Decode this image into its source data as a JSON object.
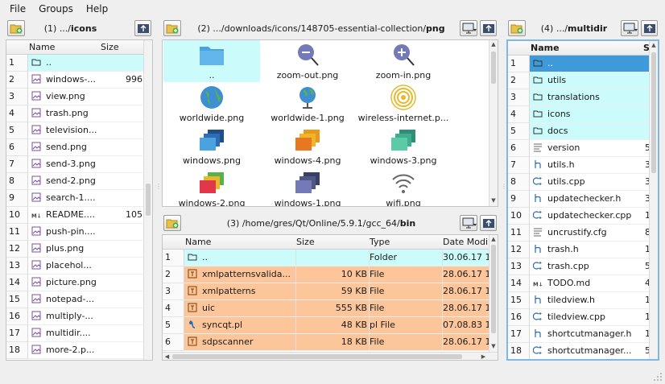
{
  "menu": [
    "File",
    "Groups",
    "Help"
  ],
  "panel1": {
    "prefix": "(1) .../",
    "bold": "icons",
    "columns": [
      "Name",
      "Size"
    ],
    "rows": [
      {
        "n": "1",
        "name": "..",
        "size": "",
        "icon": "folder-icon",
        "style": "cyan"
      },
      {
        "n": "2",
        "name": "windows-...",
        "size": "996",
        "icon": "image-file-icon"
      },
      {
        "n": "3",
        "name": "view.png",
        "size": "",
        "icon": "image-file-icon"
      },
      {
        "n": "4",
        "name": "trash.png",
        "size": "",
        "icon": "image-file-icon"
      },
      {
        "n": "5",
        "name": "television...",
        "size": "",
        "icon": "image-file-icon"
      },
      {
        "n": "6",
        "name": "send.png",
        "size": "",
        "icon": "image-file-icon"
      },
      {
        "n": "7",
        "name": "send-3.png",
        "size": "",
        "icon": "image-file-icon"
      },
      {
        "n": "8",
        "name": "send-2.png",
        "size": "",
        "icon": "image-file-icon"
      },
      {
        "n": "9",
        "name": "search-1....",
        "size": "",
        "icon": "image-file-icon"
      },
      {
        "n": "10",
        "name": "README....",
        "size": "105",
        "icon": "markdown-file-icon"
      },
      {
        "n": "11",
        "name": "push-pin....",
        "size": "",
        "icon": "image-file-icon"
      },
      {
        "n": "12",
        "name": "plus.png",
        "size": "",
        "icon": "image-file-icon"
      },
      {
        "n": "13",
        "name": "placehol...",
        "size": "",
        "icon": "image-file-icon"
      },
      {
        "n": "14",
        "name": "picture.png",
        "size": "",
        "icon": "image-file-icon"
      },
      {
        "n": "15",
        "name": "notepad-...",
        "size": "",
        "icon": "image-file-icon"
      },
      {
        "n": "16",
        "name": "multiply-...",
        "size": "",
        "icon": "image-file-icon"
      },
      {
        "n": "17",
        "name": "multidir....",
        "size": "",
        "icon": "image-file-icon"
      },
      {
        "n": "18",
        "name": "more-2.p...",
        "size": "",
        "icon": "image-file-icon"
      }
    ]
  },
  "panel2": {
    "prefix": "(2) .../downloads/icons/148705-essential-collection/",
    "bold": "png",
    "tiles": [
      {
        "label": "..",
        "icon": "folder-icon",
        "sel": true
      },
      {
        "label": "zoom-out.png",
        "icon": "zoom-out-icon"
      },
      {
        "label": "zoom-in.png",
        "icon": "zoom-in-icon"
      },
      {
        "label": "worldwide.png",
        "icon": "globe-icon"
      },
      {
        "label": "worldwide-1.png",
        "icon": "desk-globe-icon"
      },
      {
        "label": "wireless-internet.p...",
        "icon": "wireless-signal-icon"
      },
      {
        "label": "windows.png",
        "icon": "windows-stack-blue-icon"
      },
      {
        "label": "windows-4.png",
        "icon": "windows-stack-orange-icon"
      },
      {
        "label": "windows-3.png",
        "icon": "windows-stack-teal-icon"
      },
      {
        "label": "windows-2.png",
        "icon": "windows-stack-red-icon"
      },
      {
        "label": "windows-1.png",
        "icon": "windows-stack-purple-icon"
      },
      {
        "label": "wifi.png",
        "icon": "wifi-icon"
      }
    ]
  },
  "panel3": {
    "prefix": "(3) /home/gres/Qt/Online/5.9.1/gcc_64/",
    "bold": "bin",
    "columns": [
      "Name",
      "Size",
      "Type",
      "Date Modi"
    ],
    "rows": [
      {
        "n": "1",
        "name": "..",
        "size": "",
        "type": "Folder",
        "date": "30.06.17 1",
        "icon": "folder-icon",
        "style": "cyan"
      },
      {
        "n": "2",
        "name": "xmlpatternsvalida...",
        "size": "10 KB",
        "type": "File",
        "date": "28.06.17 1",
        "icon": "binary-file-icon",
        "style": "orange"
      },
      {
        "n": "3",
        "name": "xmlpatterns",
        "size": "59 KB",
        "type": "File",
        "date": "28.06.17 1",
        "icon": "binary-file-icon",
        "style": "orange"
      },
      {
        "n": "4",
        "name": "uic",
        "size": "555 KB",
        "type": "File",
        "date": "28.06.17 1",
        "icon": "binary-file-icon",
        "style": "orange"
      },
      {
        "n": "5",
        "name": "syncqt.pl",
        "size": "48 KB",
        "type": "pl File",
        "date": "07.08.83 1",
        "icon": "perl-file-icon",
        "style": "orange"
      },
      {
        "n": "6",
        "name": "sdpscanner",
        "size": "18 KB",
        "type": "File",
        "date": "28.06.17 1",
        "icon": "binary-file-icon",
        "style": "orange"
      }
    ]
  },
  "panel4": {
    "prefix": "(4) .../",
    "bold": "multidir",
    "columns": [
      "Name",
      "S"
    ],
    "rows": [
      {
        "n": "1",
        "name": "..",
        "size": "",
        "icon": "folder-icon",
        "style": "sel"
      },
      {
        "n": "2",
        "name": "utils",
        "size": "",
        "icon": "folder-icon",
        "style": "cyan"
      },
      {
        "n": "3",
        "name": "translations",
        "size": "",
        "icon": "folder-icon",
        "style": "cyan"
      },
      {
        "n": "4",
        "name": "icons",
        "size": "",
        "icon": "folder-icon",
        "style": "cyan"
      },
      {
        "n": "5",
        "name": "docs",
        "size": "",
        "icon": "folder-icon",
        "style": "cyan"
      },
      {
        "n": "6",
        "name": "version",
        "size": "5",
        "icon": "text-file-icon"
      },
      {
        "n": "7",
        "name": "utils.h",
        "size": "3",
        "icon": "header-file-icon"
      },
      {
        "n": "8",
        "name": "utils.cpp",
        "size": "3",
        "icon": "cpp-file-icon"
      },
      {
        "n": "9",
        "name": "updatechecker.h",
        "size": "3",
        "icon": "header-file-icon"
      },
      {
        "n": "10",
        "name": "updatechecker.cpp",
        "size": "1",
        "icon": "cpp-file-icon"
      },
      {
        "n": "11",
        "name": "uncrustify.cfg",
        "size": "8",
        "icon": "text-file-icon"
      },
      {
        "n": "12",
        "name": "trash.h",
        "size": "1",
        "icon": "header-file-icon"
      },
      {
        "n": "13",
        "name": "trash.cpp",
        "size": "5",
        "icon": "cpp-file-icon"
      },
      {
        "n": "14",
        "name": "TODO.md",
        "size": "4",
        "icon": "markdown-file-icon"
      },
      {
        "n": "15",
        "name": "tiledview.h",
        "size": "1",
        "icon": "header-file-icon"
      },
      {
        "n": "16",
        "name": "tiledview.cpp",
        "size": "1",
        "icon": "cpp-file-icon"
      },
      {
        "n": "17",
        "name": "shortcutmanager.h",
        "size": "1",
        "icon": "header-file-icon"
      },
      {
        "n": "18",
        "name": "shortcutmanager...",
        "size": "5",
        "icon": "cpp-file-icon"
      }
    ]
  },
  "colors": {
    "cyan_row": "#ccfbfb",
    "orange_row": "#fdc69a",
    "selection": "#3e9ad8",
    "focus_border": "#7fb8e3"
  }
}
